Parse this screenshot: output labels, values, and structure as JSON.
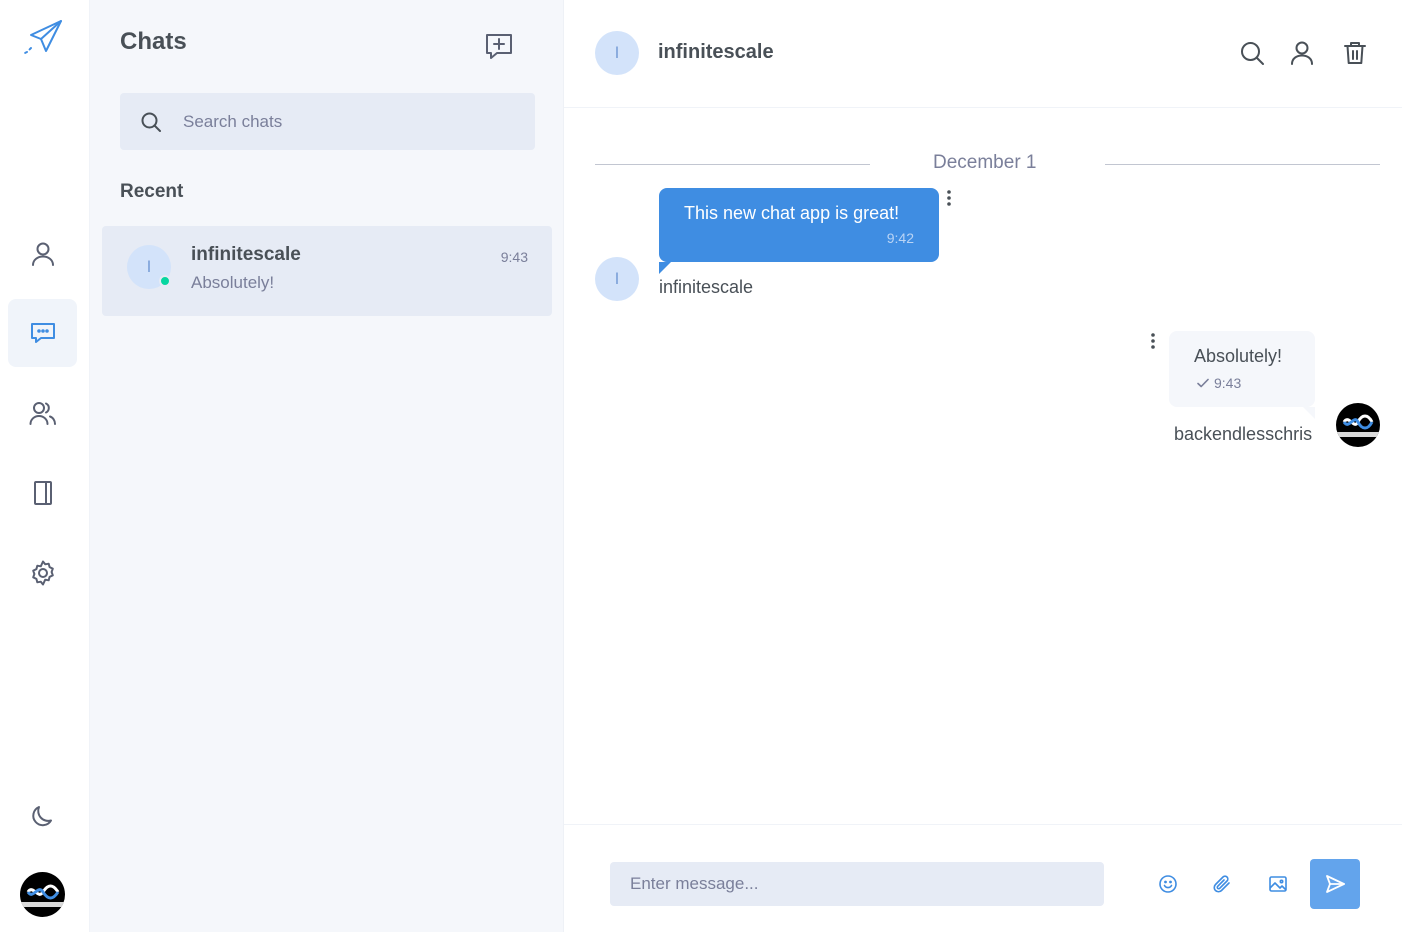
{
  "colors": {
    "accent": "#3f8de2",
    "online": "#06d6a0",
    "panel_bg": "#f5f7fb",
    "input_bg": "#e6ebf5"
  },
  "rail": {
    "logo": "paper-plane-icon",
    "items": [
      {
        "name": "profile",
        "icon": "user-icon",
        "active": false
      },
      {
        "name": "chats",
        "icon": "chat-icon",
        "active": true
      },
      {
        "name": "groups",
        "icon": "users-icon",
        "active": false
      },
      {
        "name": "contacts",
        "icon": "book-icon",
        "active": false
      },
      {
        "name": "settings",
        "icon": "gear-icon",
        "active": false
      }
    ],
    "theme_icon": "moon-icon"
  },
  "sidebar": {
    "title": "Chats",
    "search_placeholder": "Search chats",
    "recent_label": "Recent",
    "chats": [
      {
        "initial": "I",
        "name": "infinitescale",
        "preview": "Absolutely!",
        "time": "9:43",
        "online": true
      }
    ]
  },
  "conversation": {
    "initial": "I",
    "title": "infinitescale",
    "date_divider": "December 1",
    "messages": [
      {
        "direction": "in",
        "text": "This new chat app is great!",
        "time": "9:42",
        "sender": "infinitescale",
        "initial": "I"
      },
      {
        "direction": "out",
        "text": "Absolutely!",
        "time": "9:43",
        "sender": "backendlesschris"
      }
    ]
  },
  "composer": {
    "placeholder": "Enter message..."
  }
}
